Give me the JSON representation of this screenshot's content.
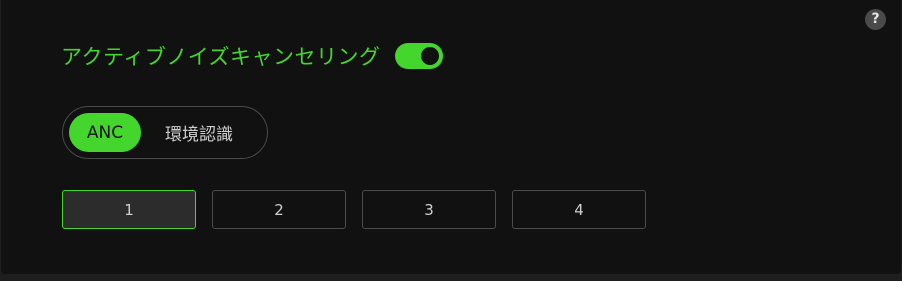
{
  "help": {
    "glyph": "?"
  },
  "anc": {
    "title": "アクティブノイズキャンセリング",
    "enabled": true
  },
  "mode": {
    "options": [
      "ANC",
      "環境認識"
    ],
    "selected": "ANC"
  },
  "levels": {
    "options": [
      "1",
      "2",
      "3",
      "4"
    ],
    "selected": "1"
  },
  "colors": {
    "accent": "#44d62c",
    "background": "#111111"
  }
}
